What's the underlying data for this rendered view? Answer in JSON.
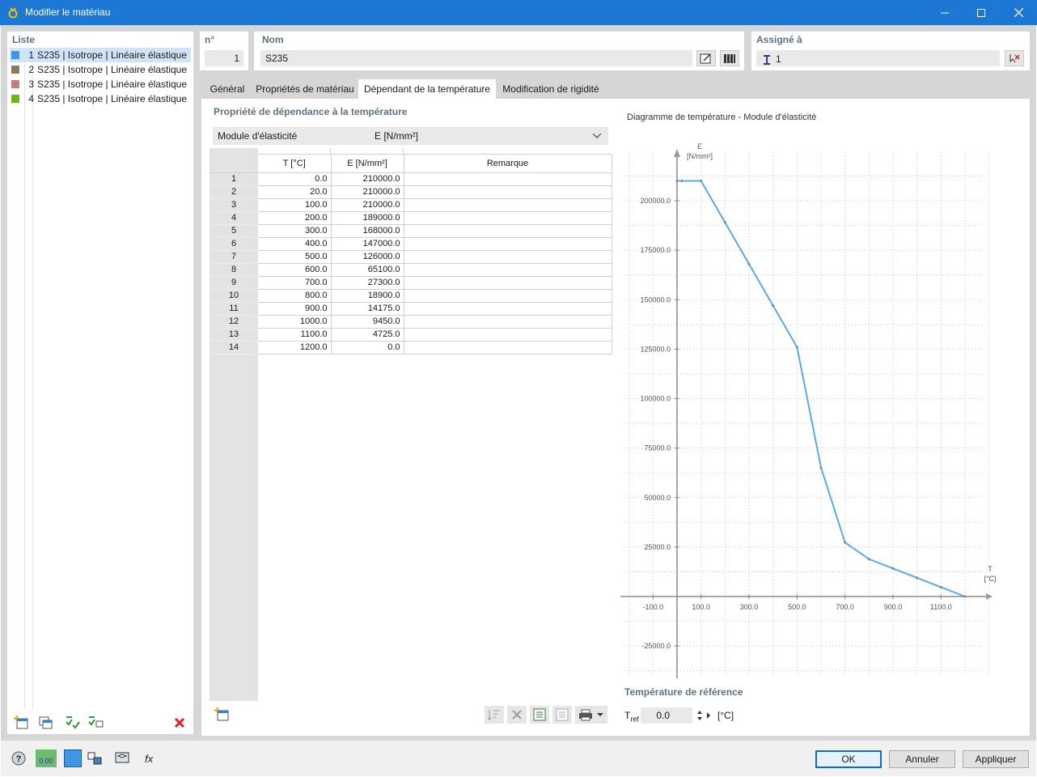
{
  "window": {
    "title": "Modifier le matériau"
  },
  "list": {
    "header": "Liste",
    "items": [
      {
        "no": "1",
        "label": "S235 | Isotrope | Linéaire élastique",
        "color": "#3d97e6"
      },
      {
        "no": "2",
        "label": "S235 | Isotrope | Linéaire élastique",
        "color": "#8c7a5f"
      },
      {
        "no": "3",
        "label": "S235 | Isotrope | Linéaire élastique",
        "color": "#c87a7a"
      },
      {
        "no": "4",
        "label": "S235 | Isotrope | Linéaire élastique",
        "color": "#6db414"
      }
    ]
  },
  "number": {
    "header": "n°",
    "value": "1"
  },
  "name": {
    "header": "Nom",
    "value": "S235"
  },
  "assigned": {
    "header": "Assigné à",
    "value": "1"
  },
  "tabs": [
    {
      "label": "Général"
    },
    {
      "label": "Propriétés de matériau"
    },
    {
      "label": "Dépendant de la température"
    },
    {
      "label": "Modification de rigidité"
    }
  ],
  "temp_section": {
    "title": "Propriété de dépendance à la température",
    "property_label": "Module d'élasticité",
    "property_symbol": "E [N/mm²]"
  },
  "table": {
    "columns": [
      "T [°C]",
      "E [N/mm²]",
      "Remarque"
    ],
    "rows": [
      {
        "n": "1",
        "T": "0.0",
        "E": "210000.0",
        "remark": ""
      },
      {
        "n": "2",
        "T": "20.0",
        "E": "210000.0",
        "remark": ""
      },
      {
        "n": "3",
        "T": "100.0",
        "E": "210000.0",
        "remark": ""
      },
      {
        "n": "4",
        "T": "200.0",
        "E": "189000.0",
        "remark": ""
      },
      {
        "n": "5",
        "T": "300.0",
        "E": "168000.0",
        "remark": ""
      },
      {
        "n": "6",
        "T": "400.0",
        "E": "147000.0",
        "remark": ""
      },
      {
        "n": "7",
        "T": "500.0",
        "E": "126000.0",
        "remark": ""
      },
      {
        "n": "8",
        "T": "600.0",
        "E": "65100.0",
        "remark": ""
      },
      {
        "n": "9",
        "T": "700.0",
        "E": "27300.0",
        "remark": ""
      },
      {
        "n": "10",
        "T": "800.0",
        "E": "18900.0",
        "remark": ""
      },
      {
        "n": "11",
        "T": "900.0",
        "E": "14175.0",
        "remark": ""
      },
      {
        "n": "12",
        "T": "1000.0",
        "E": "9450.0",
        "remark": ""
      },
      {
        "n": "13",
        "T": "1100.0",
        "E": "4725.0",
        "remark": ""
      },
      {
        "n": "14",
        "T": "1200.0",
        "E": "0.0",
        "remark": ""
      }
    ]
  },
  "chart_data": {
    "type": "line",
    "title": "Diagramme de température - Module d'élasticité",
    "xlabel": "T",
    "xunit": "[°C]",
    "ylabel": "E",
    "yunit": "[N/mm²]",
    "x": [
      0,
      20,
      100,
      200,
      300,
      400,
      500,
      600,
      700,
      800,
      900,
      1000,
      1100,
      1200
    ],
    "series": [
      {
        "values": [
          210000,
          210000,
          210000,
          189000,
          168000,
          147000,
          126000,
          65100,
          27300,
          18900,
          14175,
          9450,
          4725,
          0
        ],
        "color": "#5aa9ec"
      }
    ],
    "x_ticks": [
      "-100.0",
      "100.0",
      "300.0",
      "500.0",
      "700.0",
      "900.0",
      "1100.0"
    ],
    "x_tick_values": [
      -100,
      100,
      300,
      500,
      700,
      900,
      1100
    ],
    "y_ticks": [
      "200000.0",
      "175000.0",
      "150000.0",
      "125000.0",
      "100000.0",
      "75000.0",
      "50000.0",
      "25000.0",
      "-25000.0"
    ],
    "y_tick_values": [
      200000,
      175000,
      150000,
      125000,
      100000,
      75000,
      50000,
      25000,
      -25000
    ],
    "xlim": [
      -230,
      1300
    ],
    "ylim": [
      -40000,
      225000
    ],
    "grid": true
  },
  "reference": {
    "title": "Température de référence",
    "label": "T",
    "label_sub": "ref",
    "value": "0.0",
    "unit": "[°C]"
  },
  "buttons": {
    "ok": "OK",
    "cancel": "Annuler",
    "apply": "Appliquer"
  },
  "status": {
    "decimals": "0.00"
  }
}
